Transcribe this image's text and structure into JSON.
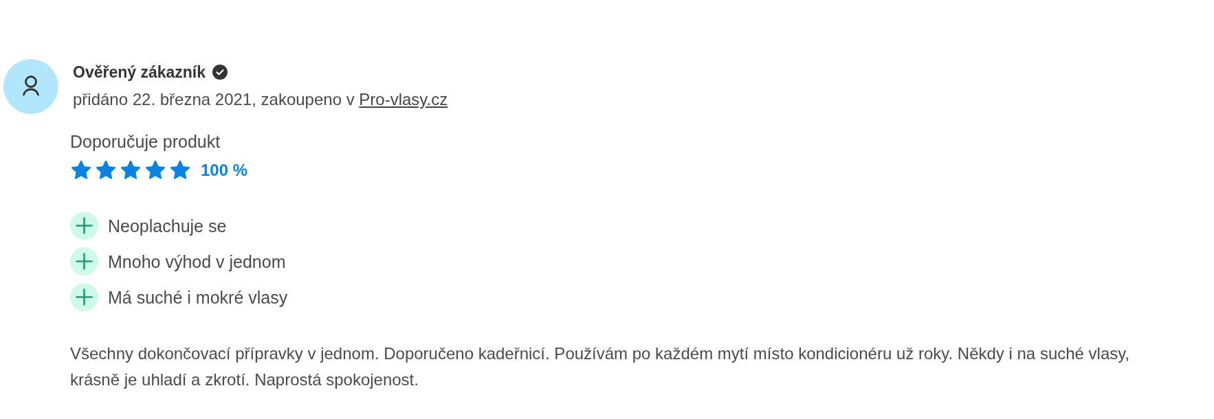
{
  "review": {
    "author": {
      "name": "Ověřený zákazník",
      "verified": true
    },
    "meta": {
      "text": "přidáno 22. března 2021, zakoupeno v",
      "store_link": "Pro-vlasy.cz"
    },
    "recommendation": {
      "label": "Doporučuje produkt",
      "stars": 5,
      "percent": "100 %"
    },
    "pros": [
      {
        "kind": "plus",
        "text": "Neoplachuje se"
      },
      {
        "kind": "plus",
        "text": "Mnoho výhod v jednom"
      },
      {
        "kind": "plus",
        "text": "Má suché i mokré vlasy"
      }
    ],
    "text": "Všechny dokončovací přípravky v jednom. Doporučeno kadeřnicí. Používám po každém mytí místo kondicionéru už roky. Někdy i na suché vlasy, krásně je uhladí a zkrotí. Naprostá spokojenost."
  }
}
